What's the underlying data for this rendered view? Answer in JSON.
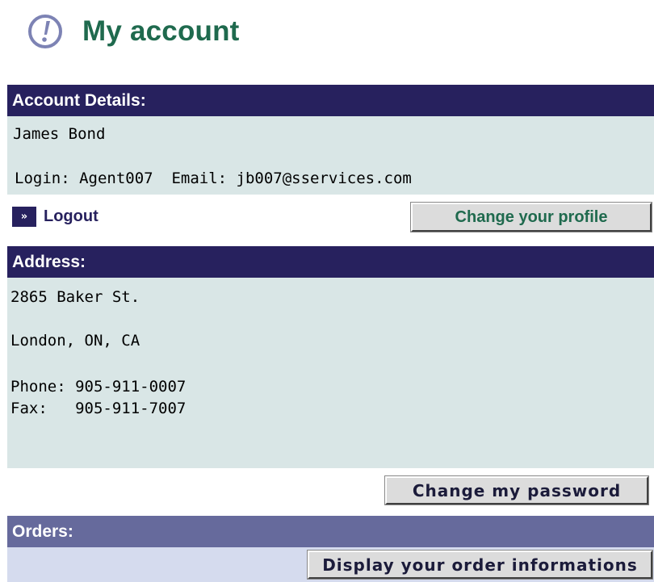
{
  "page": {
    "title": "My account"
  },
  "account_details": {
    "heading": "Account Details:",
    "name": "James Bond",
    "login_email_line": "Login: Agent007  Email: jb007@sservices.com",
    "logout_label": "Logout",
    "change_profile_label": "Change your profile"
  },
  "address": {
    "heading": "Address:",
    "street": "2865 Baker St.",
    "city_line": "London, ON, CA",
    "phone_line": "Phone: 905-911-0007",
    "fax_line": "Fax:   905-911-7007",
    "change_password_label": "Change my password"
  },
  "orders": {
    "heading": "Orders:",
    "display_orders_label": "Display your order informations"
  },
  "icons": {
    "title_icon": "exclamation-circle-icon",
    "logout_icon": "double-chevron-right-icon"
  },
  "colors": {
    "title_green": "#1f6a4e",
    "header_navy": "#27215e",
    "header_muted": "#666a9c",
    "panel_teal": "#d9e6e6",
    "panel_lavender": "#d5dbee"
  }
}
